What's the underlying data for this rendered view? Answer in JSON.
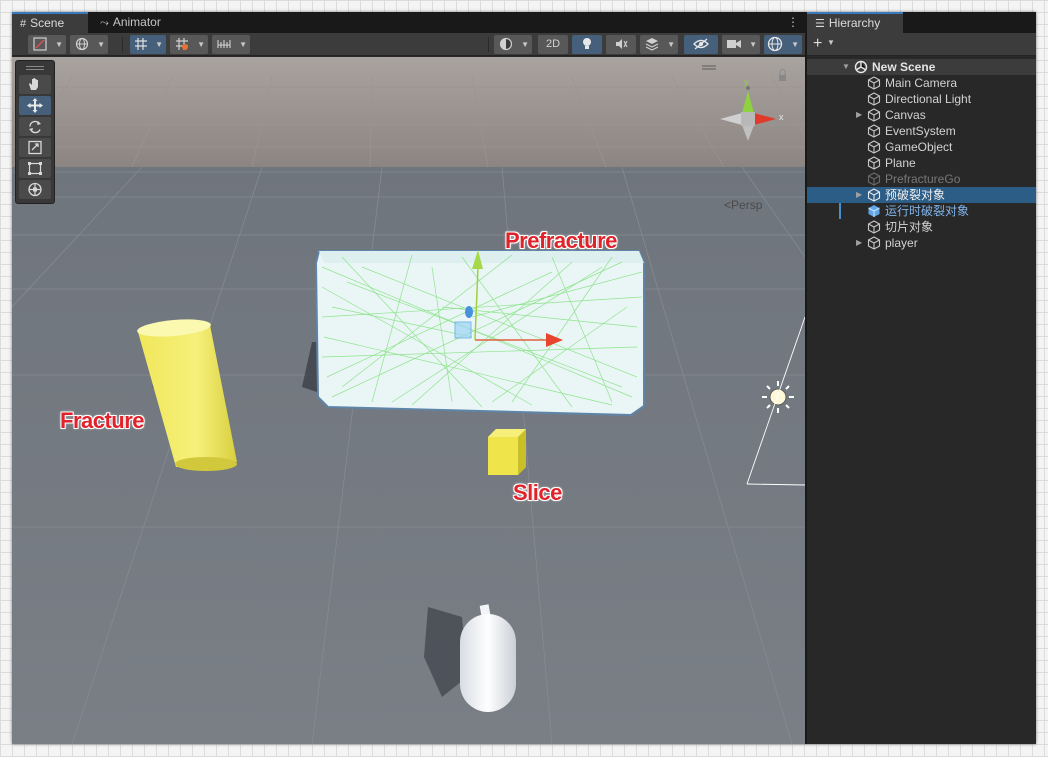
{
  "scene_tabs": {
    "scene_label": "Scene",
    "animator_label": "Animator",
    "menu_glyph": "⋮"
  },
  "scene_toolbar": {
    "mode_2d_label": "2D"
  },
  "viewport": {
    "labels": {
      "prefracture": "Prefracture",
      "fracture": "Fracture",
      "slice": "Slice"
    },
    "projection_label": "Persp",
    "gizmo_axis_x": "x",
    "gizmo_axis_y": "y"
  },
  "hierarchy": {
    "tab_label": "Hierarchy",
    "add_label": "+",
    "scene_name": "New Scene",
    "items": [
      {
        "name": "Main Camera"
      },
      {
        "name": "Directional Light"
      },
      {
        "name": "Canvas"
      },
      {
        "name": "EventSystem"
      },
      {
        "name": "GameObject"
      },
      {
        "name": "Plane"
      },
      {
        "name": "PrefractureGo"
      },
      {
        "name": "预破裂对象"
      },
      {
        "name": "运行时破裂对象"
      },
      {
        "name": "切片对象"
      },
      {
        "name": "player"
      }
    ]
  },
  "colors": {
    "accent_blue": "#3a79bb",
    "selection": "#2c5d87",
    "label_red": "#e0222a",
    "prefab_text": "#7fb4ec"
  }
}
